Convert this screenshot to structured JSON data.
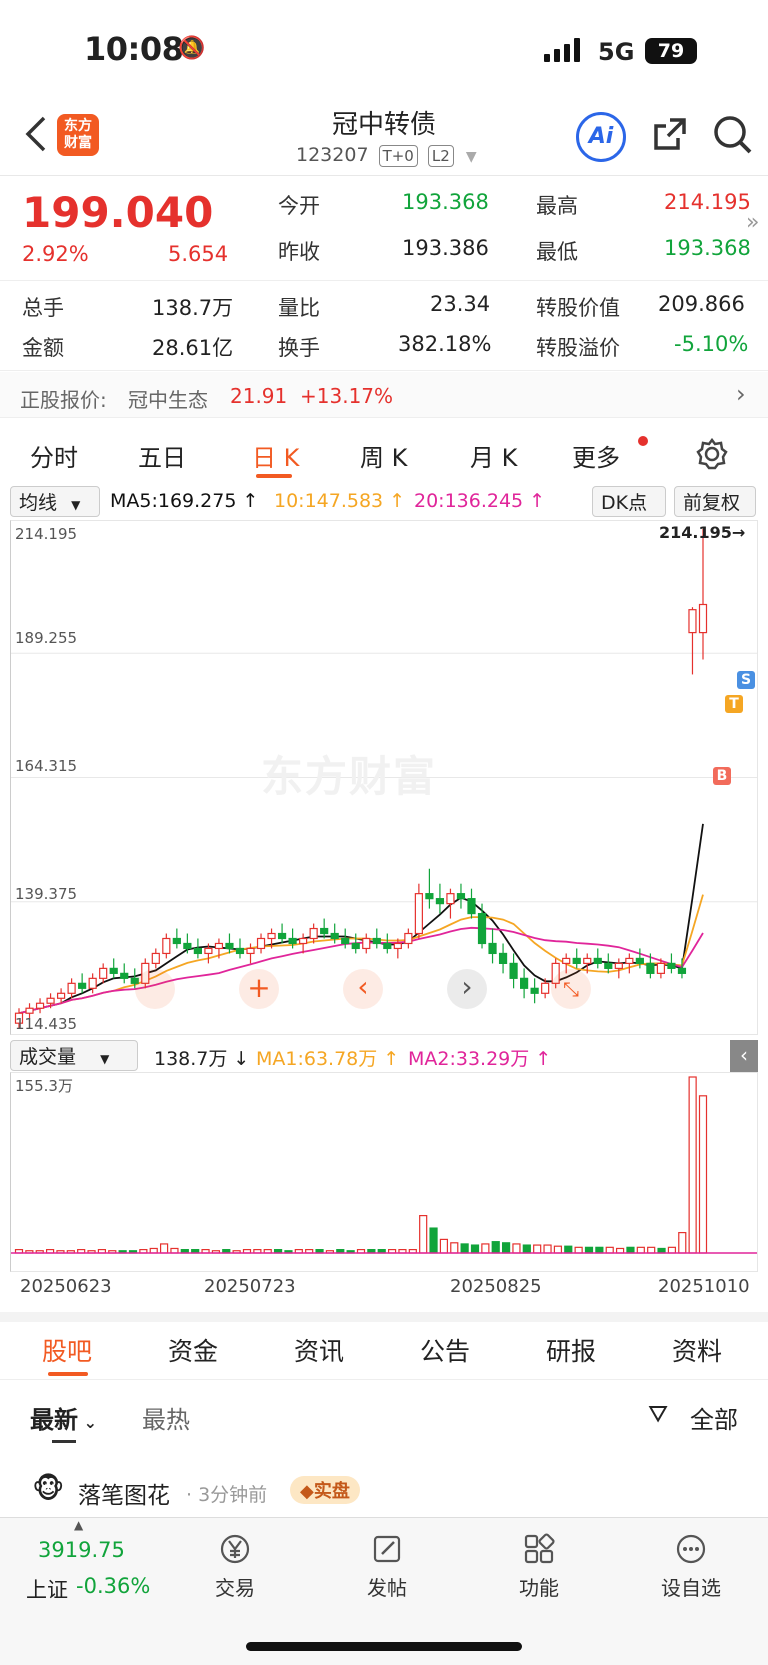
{
  "status": {
    "time": "10:08",
    "network": "5G",
    "battery": "79"
  },
  "header": {
    "logo": "东方\n财富",
    "title": "冠中转债",
    "code": "123207",
    "tag1": "T+0",
    "tag2": "L2"
  },
  "quote": {
    "price": "199.040",
    "pct": "2.92%",
    "chg": "5.654",
    "open_label": "今开",
    "open": "193.368",
    "high_label": "最高",
    "high": "214.195",
    "prev_label": "昨收",
    "prev": "193.386",
    "low_label": "最低",
    "low": "193.368",
    "vol_label": "总手",
    "vol": "138.7万",
    "ratio_label": "量比",
    "ratio": "23.34",
    "conv_label": "转股价值",
    "conv": "209.866",
    "amt_label": "金额",
    "amt": "28.61亿",
    "turn_label": "换手",
    "turn": "382.18%",
    "prem_label": "转股溢价",
    "prem": "-5.10%"
  },
  "stock_row": {
    "label": "正股报价:",
    "name": "冠中生态",
    "price": "21.91",
    "pct": "+13.17%"
  },
  "tabs": [
    "分时",
    "五日",
    "日 K",
    "周 K",
    "月 K",
    "更多"
  ],
  "chart_toolbar": {
    "ma_type": "均线",
    "ma5": "MA5:169.275 ↑",
    "ma10": "10:147.583 ↑",
    "ma20": "20:136.245 ↑",
    "dk": "DK点",
    "adj": "前复权"
  },
  "price_axis": [
    "214.195",
    "189.255",
    "164.315",
    "139.375",
    "114.435"
  ],
  "high_marker": "214.195→",
  "watermark": "东方财富",
  "markers": {
    "s": "S",
    "t": "T",
    "b": "B"
  },
  "vol_toolbar": {
    "type": "成交量",
    "vol": "138.7万 ↓",
    "ma1": "MA1:63.78万 ↑",
    "ma2": "MA2:33.29万 ↑"
  },
  "vol_axis": "155.3万",
  "dates": [
    "20250623",
    "20250723",
    "20250825",
    "20251010"
  ],
  "bottom_tabs": [
    "股吧",
    "资金",
    "资讯",
    "公告",
    "研报",
    "资料"
  ],
  "feed_sort": {
    "latest": "最新",
    "hot": "最热",
    "filter": "全部"
  },
  "post": {
    "user": "落笔图花",
    "time": "· 3分钟前",
    "badge": "实盘"
  },
  "nav": {
    "index_value": "3919.75",
    "index_label": "上证",
    "index_pct": "-0.36%",
    "trade": "交易",
    "post": "发帖",
    "func": "功能",
    "watch": "设自选"
  },
  "colors": {
    "up": "#e5312d",
    "down": "#11a43b",
    "accent": "#f25a22",
    "ma5": "#111111",
    "ma10": "#f5a623",
    "ma20": "#e0259a"
  },
  "chart_data": {
    "type": "candlestick",
    "price_range": [
      114.435,
      214.195
    ],
    "candles": [
      [
        115,
        118,
        114,
        117
      ],
      [
        117,
        119,
        116,
        118
      ],
      [
        118,
        120,
        117,
        119
      ],
      [
        119,
        121,
        118,
        120
      ],
      [
        120,
        122,
        119,
        121
      ],
      [
        121,
        124,
        120,
        123
      ],
      [
        123,
        125,
        121,
        122
      ],
      [
        122,
        125,
        121,
        124
      ],
      [
        124,
        127,
        123,
        126
      ],
      [
        126,
        128,
        124,
        125
      ],
      [
        125,
        127,
        123,
        124
      ],
      [
        124,
        126,
        122,
        123
      ],
      [
        123,
        128,
        122,
        127
      ],
      [
        127,
        130,
        126,
        129
      ],
      [
        129,
        133,
        128,
        132
      ],
      [
        132,
        134,
        130,
        131
      ],
      [
        131,
        133,
        129,
        130
      ],
      [
        130,
        132,
        128,
        129
      ],
      [
        129,
        131,
        127,
        130
      ],
      [
        130,
        132,
        128,
        131
      ],
      [
        131,
        133,
        129,
        130
      ],
      [
        130,
        132,
        128,
        129
      ],
      [
        129,
        131,
        127,
        130
      ],
      [
        130,
        133,
        129,
        132
      ],
      [
        132,
        134,
        130,
        133
      ],
      [
        133,
        135,
        131,
        132
      ],
      [
        132,
        134,
        130,
        131
      ],
      [
        131,
        133,
        129,
        132
      ],
      [
        132,
        135,
        131,
        134
      ],
      [
        134,
        136,
        132,
        133
      ],
      [
        133,
        135,
        131,
        132
      ],
      [
        132,
        134,
        130,
        131
      ],
      [
        131,
        133,
        129,
        130
      ],
      [
        130,
        133,
        129,
        132
      ],
      [
        132,
        134,
        130,
        131
      ],
      [
        131,
        133,
        129,
        130
      ],
      [
        130,
        132,
        128,
        131
      ],
      [
        131,
        134,
        130,
        133
      ],
      [
        133,
        143,
        132,
        141
      ],
      [
        141,
        146,
        138,
        140
      ],
      [
        140,
        143,
        137,
        139
      ],
      [
        139,
        142,
        136,
        141
      ],
      [
        141,
        143,
        138,
        140
      ],
      [
        140,
        142,
        136,
        137
      ],
      [
        137,
        139,
        130,
        131
      ],
      [
        131,
        134,
        127,
        129
      ],
      [
        129,
        131,
        125,
        127
      ],
      [
        127,
        129,
        122,
        124
      ],
      [
        124,
        126,
        120,
        122
      ],
      [
        122,
        124,
        119,
        121
      ],
      [
        121,
        124,
        120,
        123
      ],
      [
        123,
        128,
        122,
        127
      ],
      [
        127,
        129,
        125,
        128
      ],
      [
        128,
        130,
        126,
        127
      ],
      [
        127,
        129,
        125,
        128
      ],
      [
        128,
        130,
        126,
        127
      ],
      [
        127,
        129,
        125,
        126
      ],
      [
        126,
        128,
        124,
        127
      ],
      [
        127,
        129,
        125,
        128
      ],
      [
        128,
        130,
        126,
        127
      ],
      [
        127,
        129,
        124,
        125
      ],
      [
        125,
        128,
        124,
        127
      ],
      [
        127,
        129,
        125,
        126
      ],
      [
        126,
        128,
        124,
        125
      ],
      [
        193.4,
        198.5,
        185,
        198
      ],
      [
        193.4,
        214.195,
        188,
        199.04
      ]
    ],
    "volumes": [
      3,
      2,
      2,
      3,
      2,
      2,
      3,
      2,
      3,
      2,
      2,
      2,
      3,
      4,
      8,
      4,
      3,
      3,
      3,
      2,
      3,
      2,
      3,
      3,
      3,
      3,
      2,
      3,
      3,
      3,
      2,
      3,
      2,
      3,
      3,
      3,
      3,
      3,
      3,
      33,
      22,
      12,
      9,
      8,
      7,
      8,
      10,
      9,
      8,
      7,
      7,
      7,
      6,
      6,
      5,
      5,
      5,
      5,
      4,
      5,
      5,
      5,
      4,
      5,
      18,
      155.3,
      138.7
    ]
  }
}
